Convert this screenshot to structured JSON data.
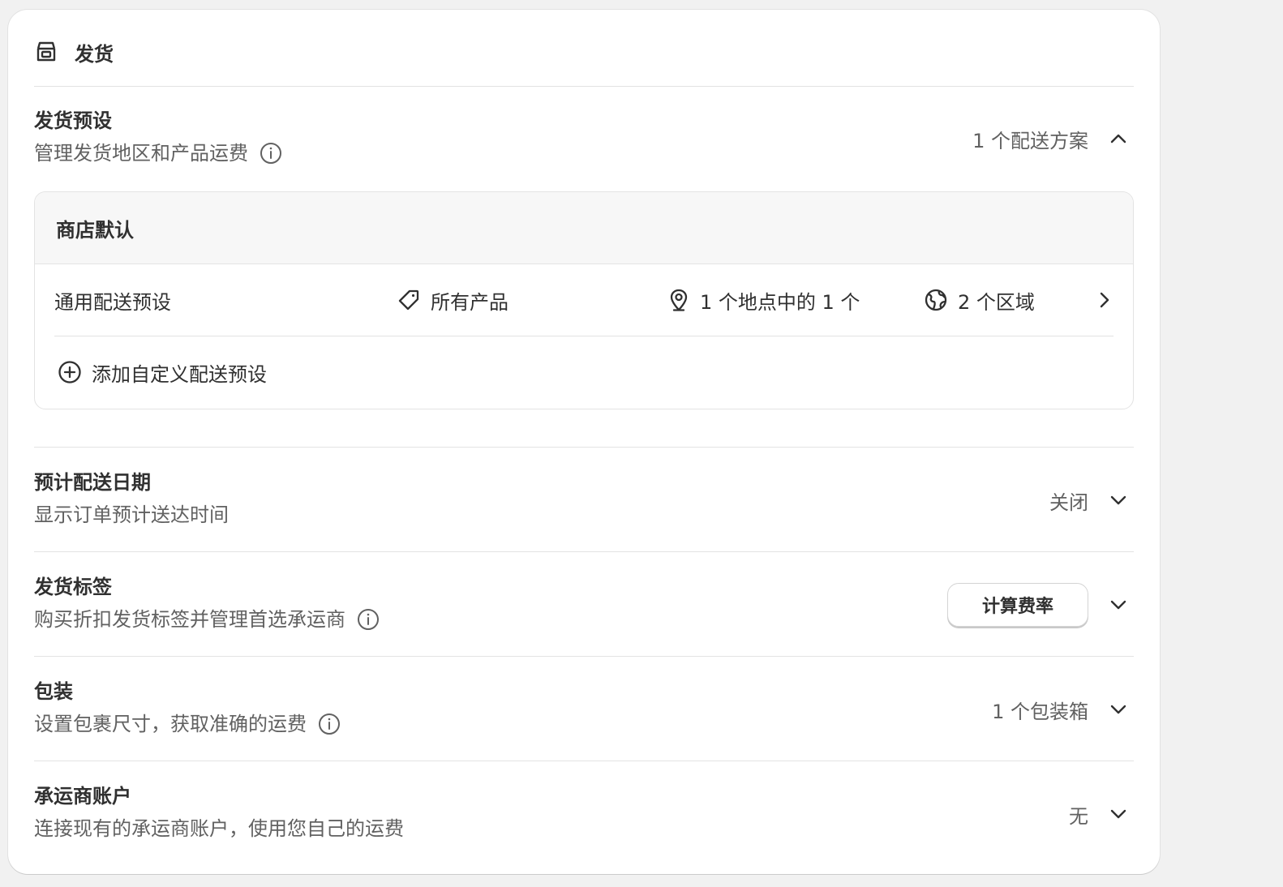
{
  "card": {
    "title": "发货"
  },
  "shipping_profiles": {
    "title": "发货预设",
    "description": "管理发货地区和产品运费",
    "summary": "1 个配送方案",
    "zone_box": {
      "header": "商店默认",
      "profile": {
        "name": "通用配送预设",
        "products": "所有产品",
        "locations": "1 个地点中的 1 个",
        "zones": "2 个区域"
      },
      "add_label": "添加自定义配送预设"
    }
  },
  "sections": [
    {
      "title": "预计配送日期",
      "description": "显示订单预计送达时间",
      "value": "关闭"
    },
    {
      "title": "发货标签",
      "description": "购买折扣发货标签并管理首选承运商",
      "button": "计算费率"
    },
    {
      "title": "包装",
      "description": "设置包裹尺寸，获取准确的运费",
      "value": "1 个包装箱"
    },
    {
      "title": "承运商账户",
      "description": "连接现有的承运商账户，使用您自己的运费",
      "value": "无"
    }
  ]
}
